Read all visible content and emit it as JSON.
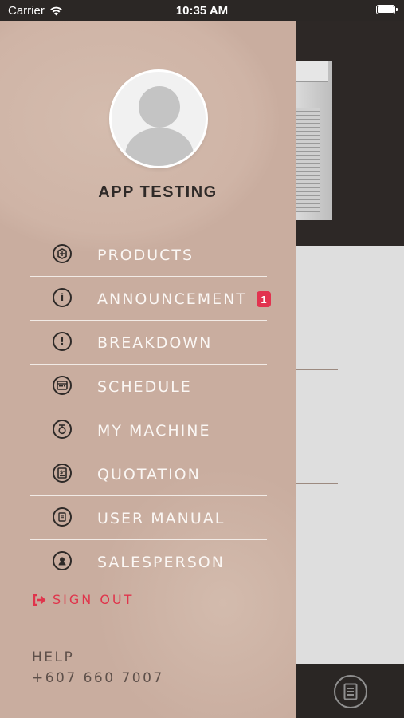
{
  "status_bar": {
    "carrier": "Carrier",
    "time": "10:35 AM"
  },
  "profile": {
    "name": "APP TESTING"
  },
  "menu": [
    {
      "label": "PRODUCTS",
      "icon": "products-icon"
    },
    {
      "label": "ANNOUNCEMENT",
      "icon": "info-icon",
      "badge": "1"
    },
    {
      "label": "BREAKDOWN",
      "icon": "exclamation-icon"
    },
    {
      "label": "SCHEDULE",
      "icon": "calendar-icon"
    },
    {
      "label": "MY MACHINE",
      "icon": "machine-icon"
    },
    {
      "label": "QUOTATION",
      "icon": "quotation-icon"
    },
    {
      "label": "USER MANUAL",
      "icon": "manual-icon"
    },
    {
      "label": "SALESPERSON",
      "icon": "person-icon"
    }
  ],
  "sign_out": {
    "label": "SIGN OUT",
    "icon": "sign-out-icon",
    "color": "#e0344b"
  },
  "help": {
    "label": "HELP",
    "phone": "+607 660 7007"
  },
  "colors": {
    "drawer_bg": "#c9ad9f",
    "badge": "#e2334f",
    "status_bar": "#2b2725"
  }
}
